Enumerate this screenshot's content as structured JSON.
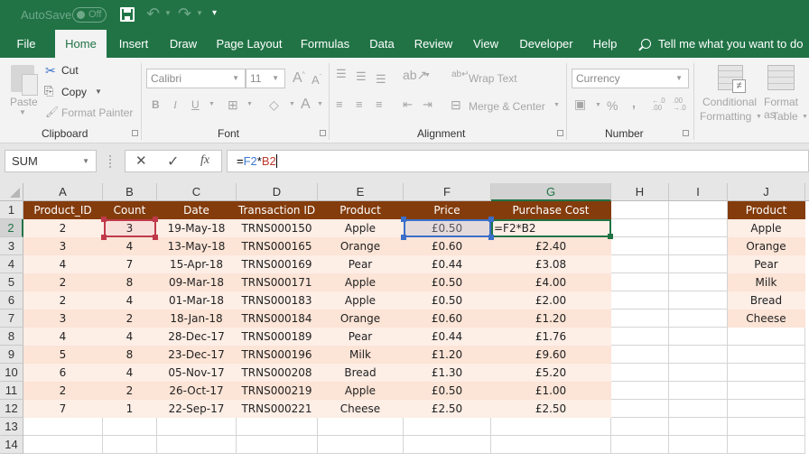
{
  "titlebar": {
    "autosave_label": "AutoSave",
    "autosave_state": "Off"
  },
  "tabs": [
    {
      "label": "File"
    },
    {
      "label": "Home",
      "active": true
    },
    {
      "label": "Insert"
    },
    {
      "label": "Draw"
    },
    {
      "label": "Page Layout"
    },
    {
      "label": "Formulas"
    },
    {
      "label": "Data"
    },
    {
      "label": "Review"
    },
    {
      "label": "View"
    },
    {
      "label": "Developer"
    },
    {
      "label": "Help"
    }
  ],
  "tellme": "Tell me what you want to do",
  "ribbon": {
    "clipboard": {
      "paste": "Paste",
      "cut": "Cut",
      "copy": "Copy",
      "format_painter": "Format Painter",
      "label": "Clipboard"
    },
    "font": {
      "font_name": "Calibri",
      "font_size": "11",
      "bold": "B",
      "italic": "I",
      "underline": "U",
      "label": "Font"
    },
    "alignment": {
      "wrap_text": "Wrap Text",
      "merge_center": "Merge & Center",
      "label": "Alignment"
    },
    "number": {
      "format": "Currency",
      "percent": "%",
      "comma": ",",
      "label": "Number"
    },
    "styles": {
      "conditional_formatting_line1": "Conditional",
      "conditional_formatting_line2": "Formatting",
      "format_as_table_line1": "Format as",
      "format_as_table_line2": "Table"
    }
  },
  "formula_bar": {
    "name_box": "SUM",
    "cancel_glyph": "✕",
    "enter_glyph": "✓",
    "fx_glyph": "fx",
    "formula_prefix": "=",
    "formula_ref1": "F2",
    "formula_op": "*",
    "formula_ref2": "B2"
  },
  "sheet": {
    "columns": [
      "A",
      "B",
      "C",
      "D",
      "E",
      "F",
      "G",
      "H",
      "I",
      "J"
    ],
    "rows": [
      "1",
      "2",
      "3",
      "4",
      "5",
      "6",
      "7",
      "8",
      "9",
      "10",
      "11",
      "12",
      "13",
      "14"
    ],
    "selected_column": "G",
    "selected_row": "2",
    "header": [
      "Product_ID",
      "Count",
      "Date",
      "Transaction ID",
      "Product",
      "Price",
      "Purchase Cost"
    ],
    "data": [
      [
        "2",
        "3",
        "19-May-18",
        "TRNS000150",
        "Apple",
        "£0.50",
        "=F2*B2"
      ],
      [
        "3",
        "4",
        "13-May-18",
        "TRNS000165",
        "Orange",
        "£0.60",
        "£2.40"
      ],
      [
        "4",
        "7",
        "15-Apr-18",
        "TRNS000169",
        "Pear",
        "£0.44",
        "£3.08"
      ],
      [
        "2",
        "8",
        "09-Mar-18",
        "TRNS000171",
        "Apple",
        "£0.50",
        "£4.00"
      ],
      [
        "2",
        "4",
        "01-Mar-18",
        "TRNS000183",
        "Apple",
        "£0.50",
        "£2.00"
      ],
      [
        "3",
        "2",
        "18-Jan-18",
        "TRNS000184",
        "Orange",
        "£0.60",
        "£1.20"
      ],
      [
        "4",
        "4",
        "28-Dec-17",
        "TRNS000189",
        "Pear",
        "£0.44",
        "£1.76"
      ],
      [
        "5",
        "8",
        "23-Dec-17",
        "TRNS000196",
        "Milk",
        "£1.20",
        "£9.60"
      ],
      [
        "6",
        "4",
        "05-Nov-17",
        "TRNS000208",
        "Bread",
        "£1.30",
        "£5.20"
      ],
      [
        "2",
        "2",
        "26-Oct-17",
        "TRNS000219",
        "Apple",
        "£0.50",
        "£1.00"
      ],
      [
        "7",
        "1",
        "22-Sep-17",
        "TRNS000221",
        "Cheese",
        "£2.50",
        "£2.50"
      ]
    ],
    "lookup_header": "Product",
    "lookup_list": [
      "Apple",
      "Orange",
      "Pear",
      "Milk",
      "Bread",
      "Cheese"
    ]
  },
  "colors": {
    "brand_green": "#217346",
    "header_brown": "#843c0c",
    "row_band_1": "#fce4d6",
    "row_band_2": "#fdeee6",
    "ref_blue": "#3b78d0",
    "ref_red": "#c0392b"
  }
}
